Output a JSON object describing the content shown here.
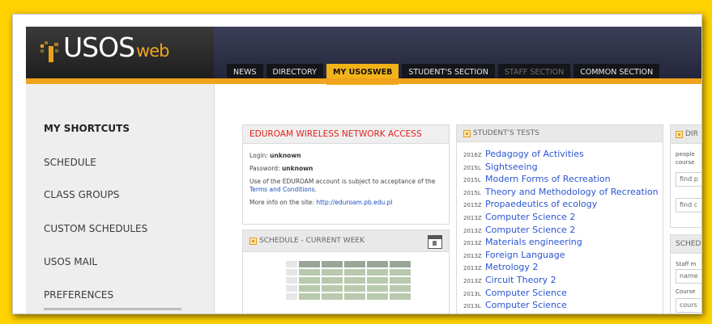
{
  "logo": {
    "main": "USOS",
    "suffix": "web"
  },
  "nav": {
    "tabs": [
      {
        "label": "NEWS",
        "state": "normal"
      },
      {
        "label": "DIRECTORY",
        "state": "normal"
      },
      {
        "label": "MY USOSWEB",
        "state": "active"
      },
      {
        "label": "STUDENT'S SECTION",
        "state": "normal"
      },
      {
        "label": "STAFF SECTION",
        "state": "disabled"
      },
      {
        "label": "COMMON SECTION",
        "state": "normal"
      }
    ]
  },
  "sidebar": {
    "items": [
      "MY SHORTCUTS",
      "SCHEDULE",
      "CLASS GROUPS",
      "CUSTOM SCHEDULES",
      "USOS MAIL",
      "PREFERENCES"
    ]
  },
  "eduroam": {
    "title": "EDUROAM WIRELESS NETWORK ACCESS",
    "login_label": "Login:",
    "login_value": "unknown",
    "password_label": "Password:",
    "password_value": "unknown",
    "terms_text": "Use of the EDUROAM account is subject to acceptance of the",
    "terms_link": "Terms and Conditions.",
    "more_text": "More info on the site:",
    "more_link": "http://eduroam.pb.edu.pl"
  },
  "schedule_panel": {
    "title": "SCHEDULE - CURRENT WEEK",
    "icon": "calendar-icon"
  },
  "tests": {
    "title": "STUDENT'S TESTS",
    "items": [
      {
        "sem": "2016Z",
        "name": "Pedagogy of Activities"
      },
      {
        "sem": "2015L",
        "name": "Sightseeing"
      },
      {
        "sem": "2015L",
        "name": "Modern Forms of Recreation"
      },
      {
        "sem": "2015L",
        "name": "Theory and Methodology of Recreation"
      },
      {
        "sem": "2015Z",
        "name": "Propaedeutics of ecology"
      },
      {
        "sem": "2013Z",
        "name": "Computer Science 2"
      },
      {
        "sem": "2013Z",
        "name": "Computer Science 2"
      },
      {
        "sem": "2013Z",
        "name": "Materials engineering"
      },
      {
        "sem": "2013Z",
        "name": "Foreign Language"
      },
      {
        "sem": "2013Z",
        "name": "Metrology 2"
      },
      {
        "sem": "2013Z",
        "name": "Circuit Theory 2"
      },
      {
        "sem": "2013L",
        "name": "Computer Science"
      },
      {
        "sem": "2013L",
        "name": "Computer Science"
      }
    ]
  },
  "directory_panel": {
    "title": "DIR",
    "text1": "people",
    "text2": "course",
    "input1_placeholder": "find p",
    "input2_placeholder": "find c"
  },
  "sched_panel2": {
    "title": "SCHED",
    "label1": "Staff m",
    "input1": "name",
    "label2": "Course",
    "input2": "cours"
  },
  "colors": {
    "accent": "#f0a31c",
    "background": "#ffd200",
    "link": "#2b55d3",
    "alert": "#e2221d"
  }
}
